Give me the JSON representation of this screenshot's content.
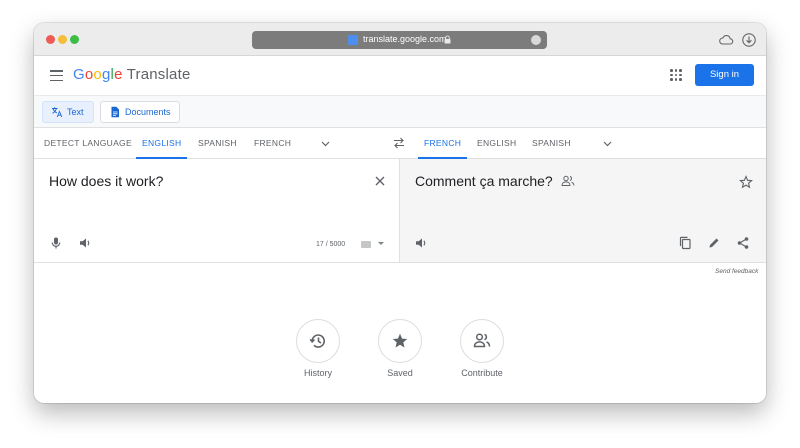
{
  "browser": {
    "url": "translate.google.com"
  },
  "header": {
    "logo_letters": [
      "G",
      "o",
      "o",
      "g",
      "l",
      "e"
    ],
    "app_name": "Translate",
    "signin_label": "Sign in"
  },
  "modes": [
    {
      "label": "Text",
      "icon": "translate-icon"
    },
    {
      "label": "Documents",
      "icon": "document-icon"
    }
  ],
  "source_langs": [
    "DETECT LANGUAGE",
    "ENGLISH",
    "SPANISH",
    "FRENCH"
  ],
  "source_active": "ENGLISH",
  "target_langs": [
    "FRENCH",
    "ENGLISH",
    "SPANISH"
  ],
  "target_active": "FRENCH",
  "source": {
    "text": "How does it work?",
    "char_count": "17 / 5000"
  },
  "target": {
    "text": "Comment ça marche?"
  },
  "feedback_label": "Send feedback",
  "quick_actions": [
    {
      "label": "History",
      "icon": "history-icon"
    },
    {
      "label": "Saved",
      "icon": "star-icon"
    },
    {
      "label": "Contribute",
      "icon": "people-icon"
    }
  ],
  "colors": {
    "accent": "#1a73e8",
    "signin_bg": "#1a73e8",
    "target_panel_bg": "#f5f5f5"
  }
}
